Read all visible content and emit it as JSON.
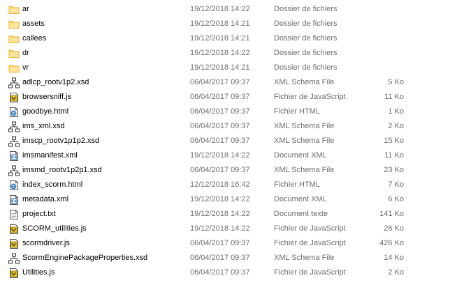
{
  "files": [
    {
      "name": "ar",
      "modified": "19/12/2018 14:22",
      "type": "Dossier de fichiers",
      "size": "",
      "icon": "folder-icon"
    },
    {
      "name": "assets",
      "modified": "19/12/2018 14:21",
      "type": "Dossier de fichiers",
      "size": "",
      "icon": "folder-icon"
    },
    {
      "name": "callees",
      "modified": "19/12/2018 14:21",
      "type": "Dossier de fichiers",
      "size": "",
      "icon": "folder-icon"
    },
    {
      "name": "dr",
      "modified": "19/12/2018 14:22",
      "type": "Dossier de fichiers",
      "size": "",
      "icon": "folder-icon"
    },
    {
      "name": "vr",
      "modified": "19/12/2018 14:21",
      "type": "Dossier de fichiers",
      "size": "",
      "icon": "folder-icon"
    },
    {
      "name": "adlcp_rootv1p2.xsd",
      "modified": "06/04/2017 09:37",
      "type": "XML Schema File",
      "size": "5 Ko",
      "icon": "xsd-schema-icon"
    },
    {
      "name": "browsersniff.js",
      "modified": "06/04/2017 09:37",
      "type": "Fichier de JavaScript",
      "size": "11 Ko",
      "icon": "javascript-file-icon"
    },
    {
      "name": "goodbye.html",
      "modified": "06/04/2017 09:37",
      "type": "Fichier HTML",
      "size": "1 Ko",
      "icon": "html-file-icon"
    },
    {
      "name": "ims_xml.xsd",
      "modified": "06/04/2017 09:37",
      "type": "XML Schema File",
      "size": "2 Ko",
      "icon": "xsd-schema-icon"
    },
    {
      "name": "imscp_rootv1p1p2.xsd",
      "modified": "06/04/2017 09:37",
      "type": "XML Schema File",
      "size": "15 Ko",
      "icon": "xsd-schema-icon"
    },
    {
      "name": "imsmanifest.xml",
      "modified": "19/12/2018 14:22",
      "type": "Document XML",
      "size": "11 Ko",
      "icon": "xml-document-icon"
    },
    {
      "name": "imsmd_rootv1p2p1.xsd",
      "modified": "06/04/2017 09:37",
      "type": "XML Schema File",
      "size": "23 Ko",
      "icon": "xsd-schema-icon"
    },
    {
      "name": "index_scorm.html",
      "modified": "12/12/2018 16:42",
      "type": "Fichier HTML",
      "size": "7 Ko",
      "icon": "html-file-icon"
    },
    {
      "name": "metadata.xml",
      "modified": "19/12/2018 14:22",
      "type": "Document XML",
      "size": "6 Ko",
      "icon": "xml-document-icon"
    },
    {
      "name": "project.txt",
      "modified": "19/12/2018 14:22",
      "type": "Document texte",
      "size": "141 Ko",
      "icon": "text-file-icon"
    },
    {
      "name": "SCORM_utilities.js",
      "modified": "19/12/2018 14:22",
      "type": "Fichier de JavaScript",
      "size": "26 Ko",
      "icon": "javascript-file-icon"
    },
    {
      "name": "scormdriver.js",
      "modified": "06/04/2017 09:37",
      "type": "Fichier de JavaScript",
      "size": "426 Ko",
      "icon": "javascript-file-icon"
    },
    {
      "name": "ScormEnginePackageProperties.xsd",
      "modified": "06/04/2017 09:37",
      "type": "XML Schema File",
      "size": "14 Ko",
      "icon": "xsd-schema-icon"
    },
    {
      "name": "Utilities.js",
      "modified": "06/04/2017 09:37",
      "type": "Fichier de JavaScript",
      "size": "2 Ko",
      "icon": "javascript-file-icon"
    }
  ],
  "colors": {
    "folder": "#ffd86b",
    "folder_dark": "#e8b33c",
    "detail_text": "#6d6d6d",
    "html_accent": "#1e73be",
    "js_accent": "#f0c419"
  }
}
